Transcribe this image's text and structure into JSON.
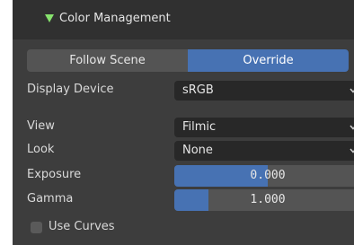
{
  "panel": {
    "title": "Color Management",
    "expanded": true
  },
  "mode_toggle": {
    "options": [
      "Follow Scene",
      "Override"
    ],
    "selected": "Override"
  },
  "display_device": {
    "label": "Display Device",
    "value": "sRGB"
  },
  "view": {
    "label": "View",
    "value": "Filmic"
  },
  "look": {
    "label": "Look",
    "value": "None"
  },
  "exposure": {
    "label": "Exposure",
    "value": "0.000"
  },
  "gamma": {
    "label": "Gamma",
    "value": "1.000"
  },
  "use_curves": {
    "label": "Use Curves",
    "checked": false
  },
  "colors": {
    "accent": "#4772b3",
    "panel_bg": "#3d3d3d",
    "header_bg": "#303030",
    "expand_arrow": "#86e26d"
  }
}
